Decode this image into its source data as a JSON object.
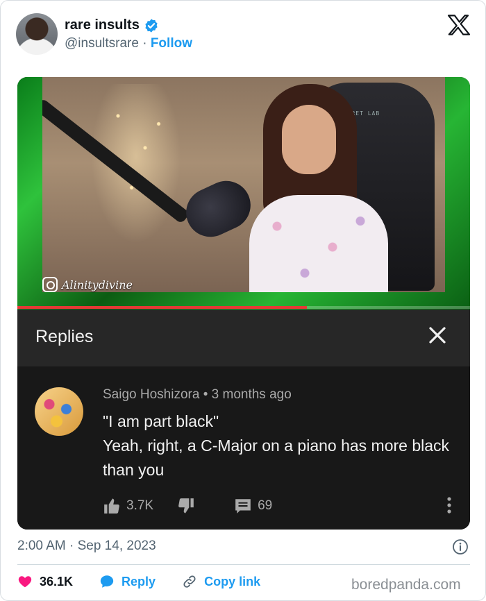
{
  "author": {
    "name": "rare insults",
    "handle": "@insultsrare",
    "separator": "·",
    "follow_label": "Follow",
    "verified_icon": "verified-badge-icon"
  },
  "brand_icon": "x-logo-icon",
  "media": {
    "watermark": "Alinitydivine",
    "chair_brand": "SECRET LAB",
    "progress_percent": 64,
    "replies_title": "Replies",
    "comment": {
      "author": "Saigo Hoshizora",
      "dot": "•",
      "age": "3 months ago",
      "line1": "\"I am part black\"",
      "line2": "Yeah, right, a C-Major on a piano has more black than you",
      "likes": "3.7K",
      "replies": "69"
    }
  },
  "timestamp": "2:00 AM · Sep 14, 2023",
  "footer": {
    "like_count": "36.1K",
    "reply_label": "Reply",
    "copy_label": "Copy link"
  },
  "credit": "boredpanda.com",
  "colors": {
    "accent": "#1d9bf0",
    "like": "#f91880",
    "dark_panel": "#272727",
    "comment_bg": "#181818"
  }
}
